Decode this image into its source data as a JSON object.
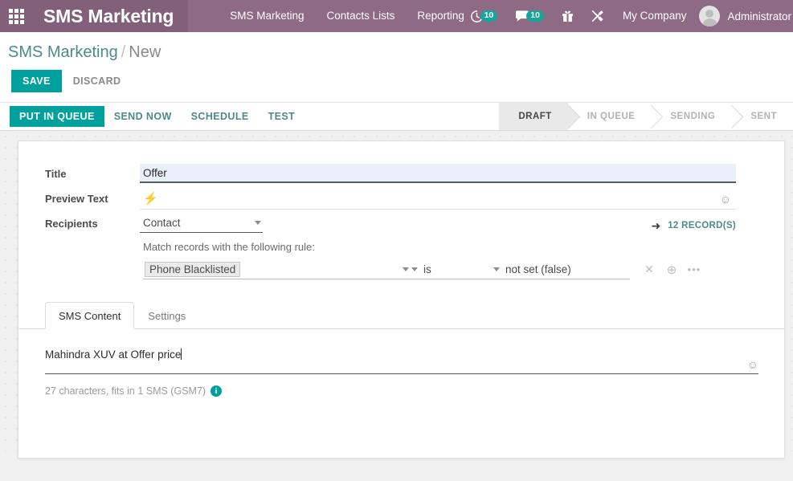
{
  "navbar": {
    "apps_icon": "apps-grid-icon",
    "brand": "SMS Marketing",
    "menu": [
      {
        "label": "SMS Marketing"
      },
      {
        "label": "Contacts Lists"
      },
      {
        "label": "Reporting"
      }
    ],
    "plus_label": "+",
    "activity_icon": "clock-activity-icon",
    "activity_count": "10",
    "messages_icon": "chat-bubble-icon",
    "messages_count": "10",
    "gift_icon": "gift-icon",
    "tools_icon": "wrench-tools-icon",
    "company": "My Company",
    "avatar_icon": "user-avatar-icon",
    "username": "Administrator"
  },
  "control_panel": {
    "breadcrumb_root": "SMS Marketing",
    "breadcrumb_sep": "/",
    "breadcrumb_current": "New",
    "save_label": "SAVE",
    "discard_label": "DISCARD"
  },
  "action_bar": {
    "buttons": [
      {
        "label": "PUT IN QUEUE",
        "primary": true
      },
      {
        "label": "SEND NOW",
        "primary": false
      },
      {
        "label": "SCHEDULE",
        "primary": false
      },
      {
        "label": "TEST",
        "primary": false
      }
    ],
    "stages": [
      {
        "label": "DRAFT",
        "active": true
      },
      {
        "label": "IN QUEUE",
        "active": false
      },
      {
        "label": "SENDING",
        "active": false
      },
      {
        "label": "SENT",
        "active": false
      }
    ]
  },
  "form": {
    "title_label": "Title",
    "title_value": "Offer",
    "preview_label": "Preview Text",
    "preview_value": "",
    "preview_bolt_icon": "⚡",
    "preview_emoji_icon": "☺",
    "recipients_label": "Recipients",
    "recipients_value": "Contact",
    "rule_hint": "Match records with the following rule:",
    "records_arrow_icon": "➜",
    "records_label": "12 RECORD(S)",
    "rule": {
      "field": "Phone Blacklisted",
      "operator": "is",
      "value": "not set (false)",
      "delete_icon": "✕",
      "add_icon": "⊕",
      "more_icon": "•••"
    }
  },
  "notebook": {
    "tabs": [
      {
        "label": "SMS Content",
        "active": true
      },
      {
        "label": "Settings",
        "active": false
      }
    ]
  },
  "sms": {
    "body_text": "Mahindra XUV at Offer price",
    "emoji_icon": "☺",
    "counter_text": "27 characters, fits in 1 SMS (GSM7)",
    "info_icon": "i"
  }
}
